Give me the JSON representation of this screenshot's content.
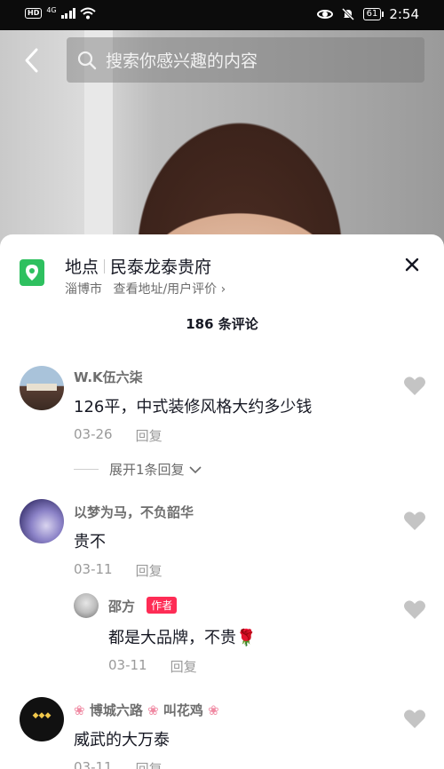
{
  "status": {
    "net": "4G",
    "hd": "HD",
    "battery": "61",
    "time": "2:54"
  },
  "search": {
    "placeholder": "搜索你感兴趣的内容"
  },
  "location": {
    "label": "地点",
    "name": "民泰龙泰贵府",
    "city": "淄博市",
    "link": "查看地址/用户评价 ›"
  },
  "comment_count": "186 条评论",
  "comments": [
    {
      "user": "W.K伍六柒",
      "text": "126平，中式装修风格大约多少钱",
      "date": "03-26",
      "reply": "回复",
      "expand": "展开1条回复"
    },
    {
      "user": "以梦为马，不负韶华",
      "text": "贵不",
      "date": "03-11",
      "reply": "回复"
    },
    {
      "user": "邵方",
      "tag": "作者",
      "text": "都是大品牌，不贵🌹",
      "date": "03-11",
      "reply": "回复"
    },
    {
      "user_parts": [
        "博城六路",
        "叫花鸡"
      ],
      "text": "威武的大万泰",
      "date": "03-11",
      "reply": "回复"
    }
  ],
  "colors": {
    "accent": "#fe2c55",
    "location_green": "#2ec05f"
  }
}
